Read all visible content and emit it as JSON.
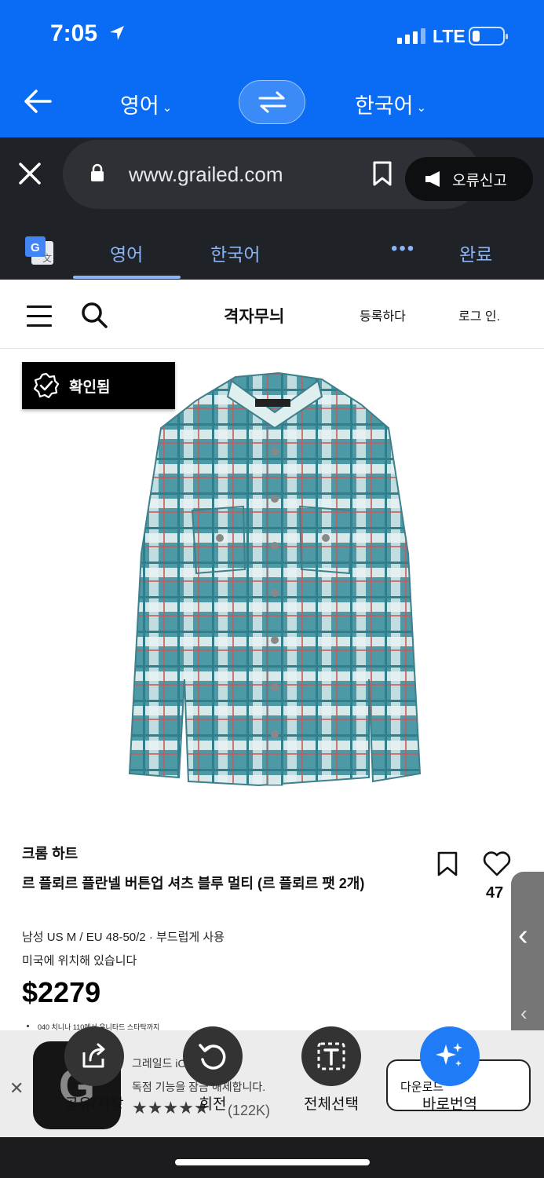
{
  "status": {
    "time": "7:05",
    "network": "LTE"
  },
  "translate_bar": {
    "source_lang": "영어",
    "target_lang": "한국어"
  },
  "browser": {
    "url": "www.grailed.com",
    "report_label": "오류신고",
    "tab_source": "영어",
    "tab_target": "한국어",
    "more": "•••",
    "done_label": "완료"
  },
  "site": {
    "logo": "격자무늬",
    "signup": "등록하다",
    "login": "로그 인."
  },
  "product": {
    "verified_badge": "확인됨",
    "brand": "크롬 하트",
    "title": "르 플뢰르 플란넬 버튼업 셔츠 블루 멀티 (르 플뢰르 팻 2개)",
    "likes": "47",
    "details": "남성 US M / EU 48-50/2 · 부드럽게 사용",
    "location": "미국에 위치해 있습니다",
    "price": "$2279",
    "shipping_note": "040 치니나 110에서 유니타드 스타탁까지"
  },
  "app_banner": {
    "app_name": "그레일드 iOS 앱",
    "description": "독점 기능을 잠금 해제합니다.",
    "stars": "★★★★★",
    "reviews": "(122K)",
    "download": "다운로드"
  },
  "actions": [
    {
      "label": "공유/저장",
      "icon": "share-icon"
    },
    {
      "label": "회전",
      "icon": "rotate-icon"
    },
    {
      "label": "전체선택",
      "icon": "select-all-icon"
    },
    {
      "label": "바로번역",
      "icon": "sparkle-icon"
    }
  ],
  "colors": {
    "accent": "#0a6cf5",
    "dark": "#1f2226"
  }
}
